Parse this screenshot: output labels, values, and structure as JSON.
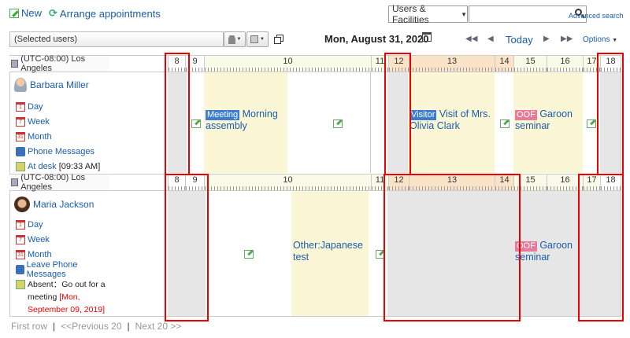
{
  "toolbar": {
    "new_label": "New",
    "arrange_label": "Arrange appointments",
    "search_scope": "Users & Facilities",
    "search_value": "",
    "advanced_search": "Advanced search"
  },
  "selector": {
    "selected_users": "(Selected users)"
  },
  "nav": {
    "date": "Mon, August 31, 2020",
    "today": "Today",
    "options": "Options"
  },
  "hours": {
    "row1": [
      "8",
      "9",
      "10",
      "11",
      "12",
      "13",
      "14",
      "15",
      "16",
      "17",
      "18"
    ],
    "row2": [
      "8",
      "9",
      "10",
      "11",
      "12",
      "13",
      "14",
      "15",
      "16",
      "17",
      "18"
    ]
  },
  "users": [
    {
      "timezone": "(UTC-08:00) Los Angeles",
      "name": "Barbara Miller",
      "links": [
        "Day",
        "Week",
        "Month",
        "Phone Messages"
      ],
      "status_label": "At desk",
      "status_detail": " [09:33 AM]",
      "appointments": [
        {
          "tag": "Meeting",
          "title": " Morning assembly"
        },
        {
          "tag": "Visitor",
          "title": " Visit of Mrs. Olivia Clark"
        },
        {
          "tag": "OOF",
          "title": " Garoon seminar"
        }
      ]
    },
    {
      "timezone": "(UTC-08:00) Los Angeles",
      "name": "Maria Jackson",
      "links": [
        "Day",
        "Week",
        "Month",
        "Leave Phone Messages"
      ],
      "status_label": "Absent：Go out for a meeting",
      "status_detail": "[Mon, September 09, 2019]",
      "appointments": [
        {
          "tag": "",
          "title": "Other:Japanese test"
        },
        {
          "tag": "OOF",
          "title": " Garoon seminar"
        }
      ]
    }
  ],
  "pager": {
    "first": "First row",
    "sep1": "|",
    "prev": "<<Previous 20",
    "sep2": "|",
    "next": "Next 20 >>"
  },
  "colors": {
    "link": "#1a5dab",
    "highlight_box": "#e00000",
    "free_slot": "#faf6d6",
    "off_hours": "#e6e6e6",
    "lunch_header": "#fbe3c8"
  }
}
